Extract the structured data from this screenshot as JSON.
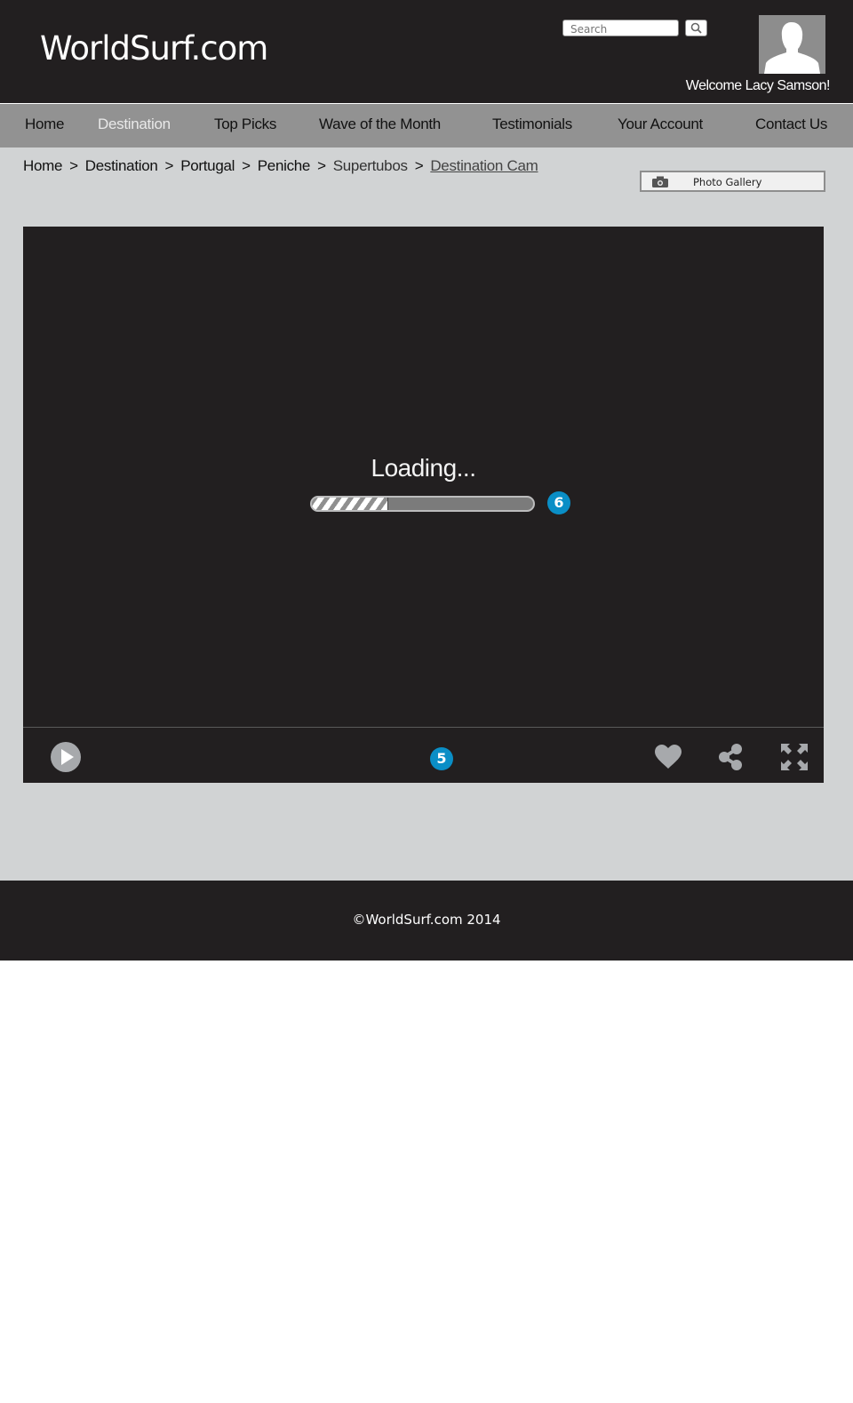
{
  "header": {
    "logo": "WorldSurf.com",
    "search_placeholder": "Search",
    "welcome": "Welcome Lacy Samson!",
    "search_icon": "search-icon",
    "avatar_icon": "user-silhouette-icon"
  },
  "nav": {
    "items": [
      {
        "label": "Home",
        "active": false
      },
      {
        "label": "Destination",
        "active": true
      },
      {
        "label": "Top Picks",
        "active": false
      },
      {
        "label": "Wave of the Month",
        "active": false
      },
      {
        "label": "Testimonials",
        "active": false
      },
      {
        "label": "Your Account",
        "active": false
      },
      {
        "label": "Contact Us",
        "active": false
      }
    ]
  },
  "breadcrumb": {
    "items": [
      "Home",
      "Destination",
      "Portugal",
      "Peniche",
      "Supertubos",
      "Destination Cam"
    ],
    "separator": ">"
  },
  "gallery_button": {
    "label": "Photo Gallery",
    "icon": "camera-icon"
  },
  "player": {
    "loading_text": "Loading...",
    "progress": 0.34,
    "progress_badge": "6",
    "controls_badge": "5",
    "controls": [
      "play-icon",
      "heart-icon",
      "share-icon",
      "fullscreen-icon"
    ]
  },
  "footer": {
    "copyright": "©WorldSurf.com 2014"
  },
  "colors": {
    "dark": "#221f20",
    "nav_bg": "#929292",
    "content_bg": "#d1d3d4",
    "badge": "#0a8ec6",
    "icon_gray": "#a7a9ac"
  }
}
